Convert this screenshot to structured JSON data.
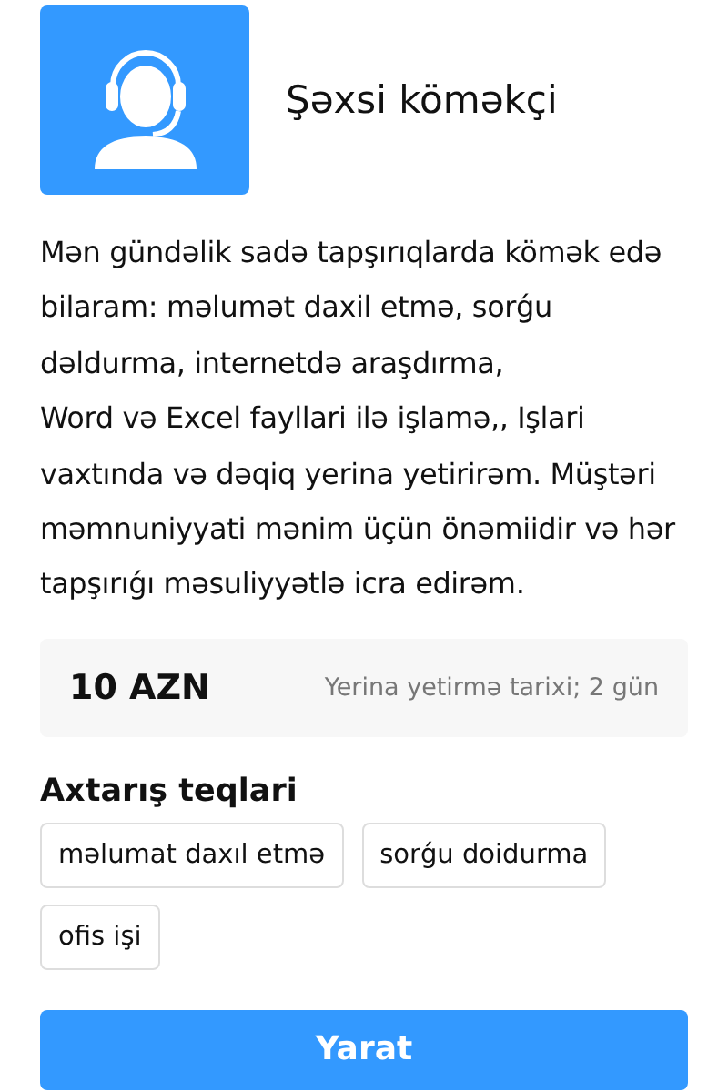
{
  "header": {
    "title": "Şəxsi köməkçi"
  },
  "description": "Mən gündəlik sadə tapşırıqlarda kömək edə bilaram: məlumət daxil etmə, sorǵu dəldurma, internetdə araşdırma,\nWord və Excel fayllari ilə işlamə,, Işlari vaxtında və dəqiq yerina yetirirəm. Müştəri məmnuniyyati mənim üçün önəmiidir və hər tapşırıǵı məsuliyyətlə icra edirəm.",
  "price": {
    "amount": "10 AZN",
    "deadline": "Yerina yetirmə tarixi; 2 gün"
  },
  "tags": {
    "title": "Axtarış teqlari",
    "items": [
      "məlumat daxıl etmə",
      "sorǵu doidurma",
      "ofis işi"
    ]
  },
  "button": "Yarat"
}
